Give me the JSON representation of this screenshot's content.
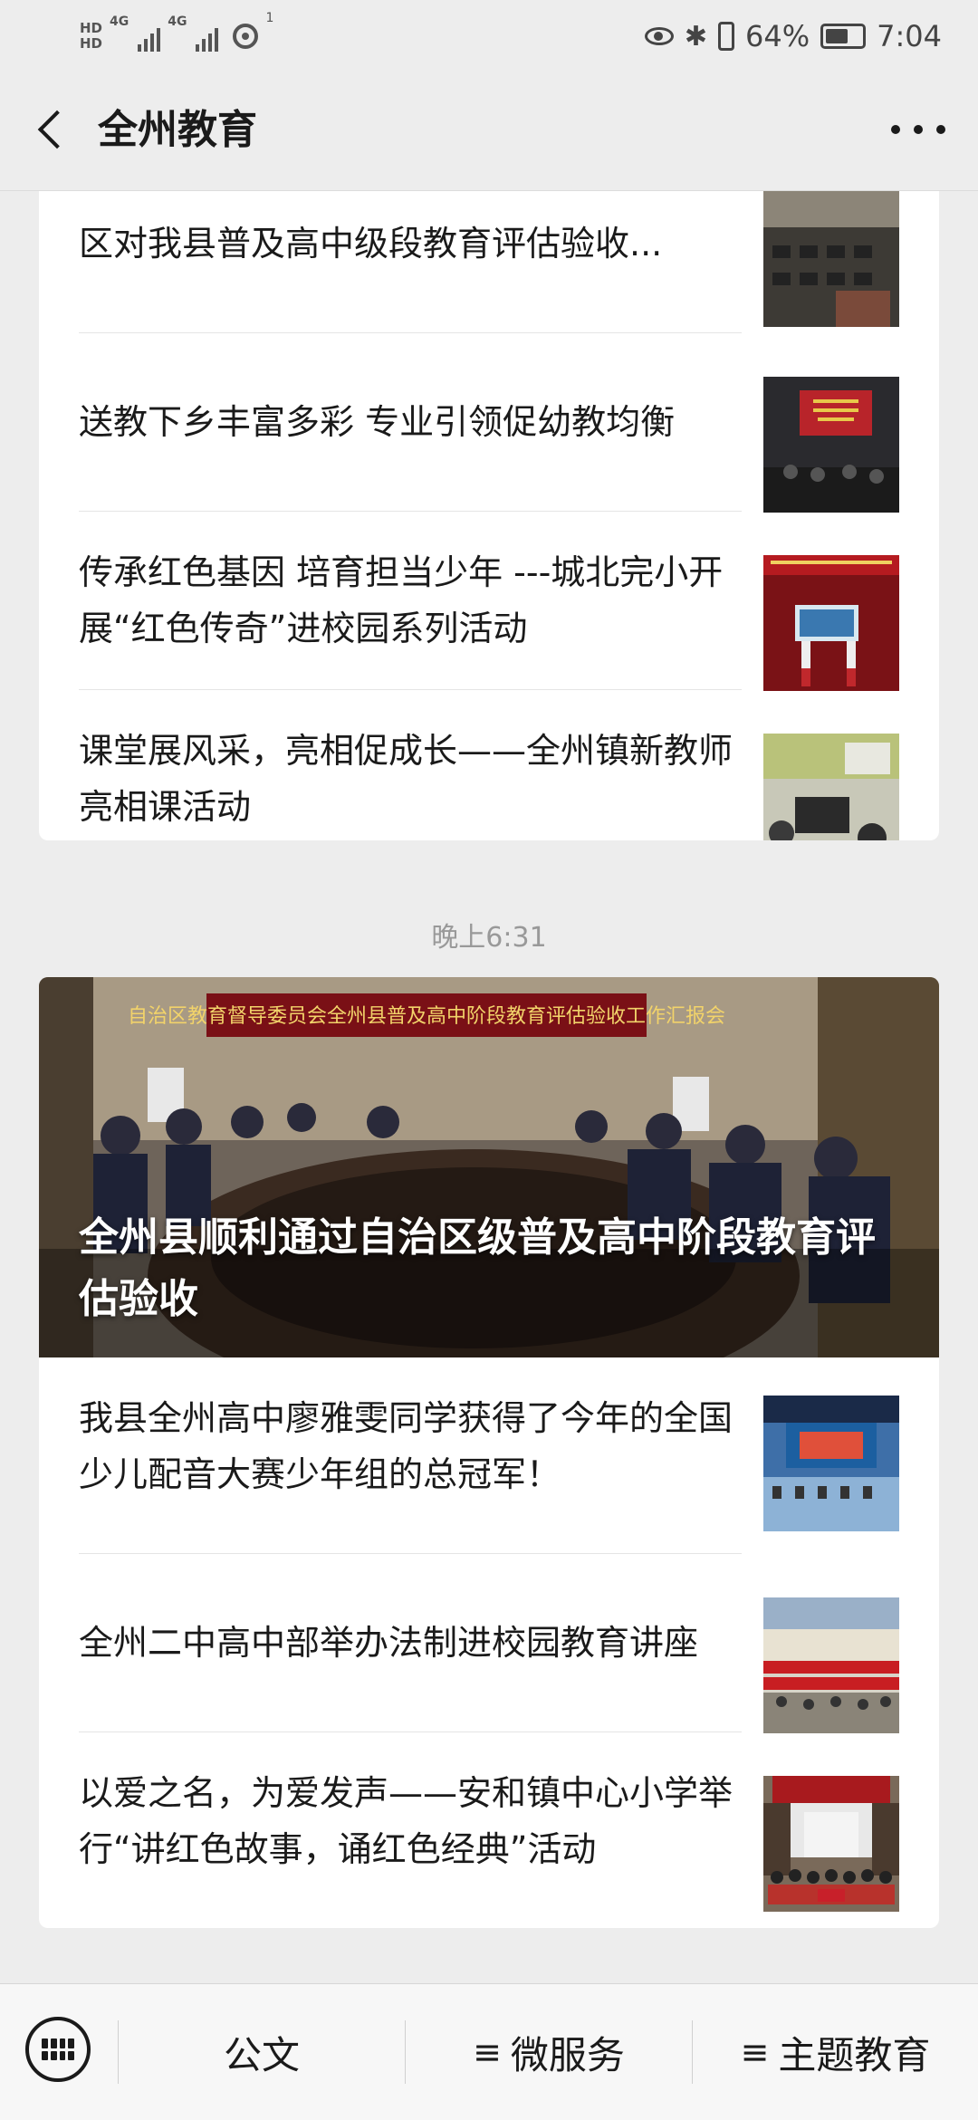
{
  "status_bar": {
    "hd1": "HD",
    "hd2": "HD",
    "net1": "4G",
    "net2": "4G",
    "hotspot_count": "1",
    "battery": "64%",
    "time": "7:04",
    "battery_level": 0.64
  },
  "nav": {
    "title": "全州教育"
  },
  "card1": {
    "items": [
      {
        "title": "区对我县普及高中级段教育评估验收..."
      },
      {
        "title": "送教下乡丰富多彩  专业引领促幼教均衡"
      },
      {
        "title": "传承红色基因 培育担当少年 ---城北完小开展“红色传奇”进校园系列活动"
      },
      {
        "title": "课堂展风采，亮相促成长——全州镇新教师亮相课活动"
      }
    ]
  },
  "timestamp": "晚上6:31",
  "card2": {
    "hero": {
      "banner": "自治区教育督导委员会全州县普及高中阶段教育评估验收工作汇报会",
      "caption": "全州县顺利通过自治区级普及高中阶段教育评估验收"
    },
    "items": [
      {
        "title": "我县全州高中廖雅雯同学获得了今年的全国少儿配音大赛少年组的总冠军！"
      },
      {
        "title": "全州二中高中部举办法制进校园教育讲座"
      },
      {
        "title": "以爱之名，为爱发声——安和镇中心小学举行“讲红色故事，诵红色经典”活动"
      }
    ]
  },
  "bottom_menu": {
    "items": [
      {
        "label": "公文"
      },
      {
        "label": "微服务"
      },
      {
        "label": "主题教育"
      }
    ],
    "submenu_glyph": "≡"
  }
}
